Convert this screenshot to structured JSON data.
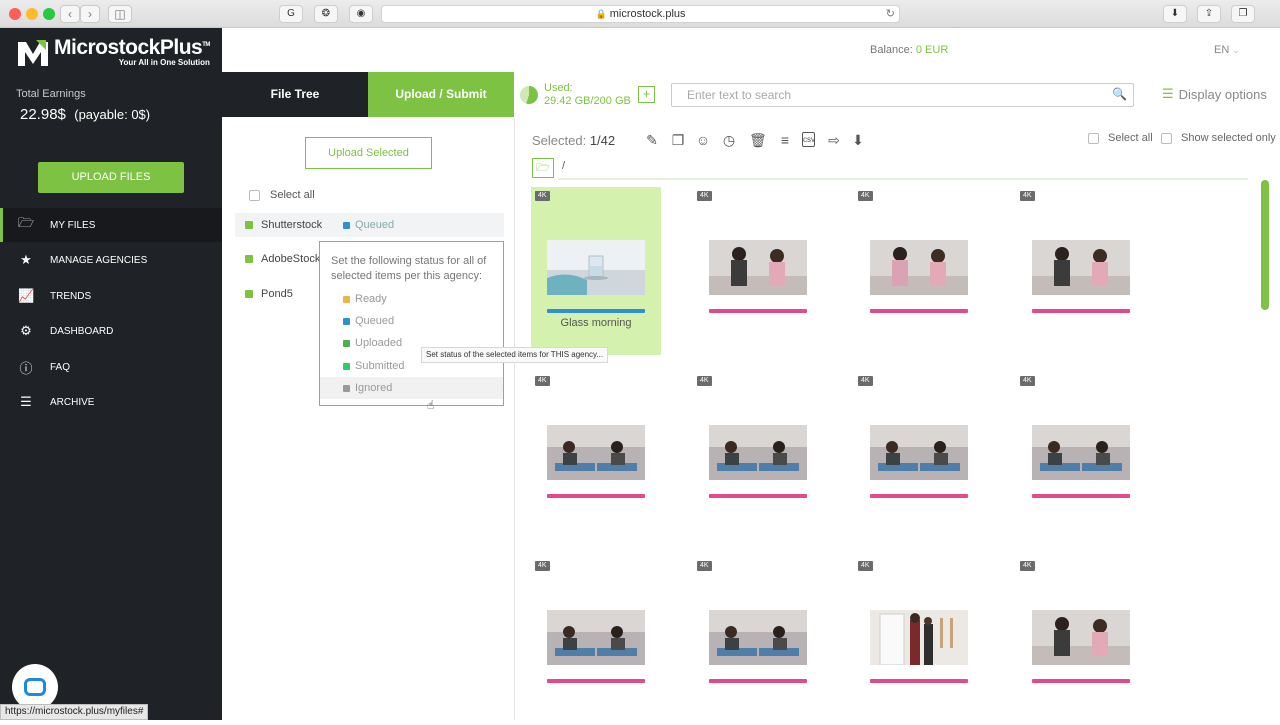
{
  "browser": {
    "url": "microstock.plus",
    "status_url": "https://microstock.plus/myfiles#"
  },
  "logo": {
    "title_a": "Microstock",
    "title_b": "Plus",
    "trademark": "TM",
    "tagline": "Your All in One Solution"
  },
  "sidebar": {
    "earnings_label": "Total Earnings",
    "earnings_value": "22.98$",
    "payable": "(payable: 0$)",
    "upload_button": "UPLOAD FILES",
    "items": [
      {
        "label": "MY FILES",
        "icon": "folder-open-icon"
      },
      {
        "label": "MANAGE AGENCIES",
        "icon": "star-icon"
      },
      {
        "label": "TRENDS",
        "icon": "line-chart-icon"
      },
      {
        "label": "DASHBOARD",
        "icon": "gears-icon"
      },
      {
        "label": "FAQ",
        "icon": "question-circle-icon"
      },
      {
        "label": "ARCHIVE",
        "icon": "list-icon"
      }
    ]
  },
  "topbar": {
    "balance_label": "Balance:",
    "balance_value": "0 EUR",
    "language": "EN"
  },
  "panel": {
    "tab_file_tree": "File Tree",
    "tab_upload": "Upload / Submit",
    "upload_selected": "Upload Selected",
    "select_all": "Select all",
    "agencies": [
      {
        "name": "Shutterstock",
        "status": "Queued"
      },
      {
        "name": "AdobeStock"
      },
      {
        "name": "Pond5"
      }
    ],
    "popup": {
      "text": "Set the following status for all of selected items per this agency:",
      "options": [
        {
          "label": "Ready",
          "color": "#f0b444"
        },
        {
          "label": "Queued",
          "color": "#2d8fd6"
        },
        {
          "label": "Uploaded",
          "color": "#4caf50"
        },
        {
          "label": "Submitted",
          "color": "#2ecc71"
        },
        {
          "label": "Ignored",
          "color": "#999999"
        }
      ]
    },
    "tooltip": "Set status of the selected items for THIS agency..."
  },
  "toolbar": {
    "used_label": "Used:",
    "used_value": "29.42 GB/200 GB",
    "search_placeholder": "Enter text to search",
    "display_options": "Display options",
    "selected_label": "Selected:",
    "selected_value": "1/42",
    "select_all": "Select all",
    "show_selected_only": "Show selected only",
    "path": "/",
    "icons": [
      "pencil-icon",
      "copy-icon",
      "smile-icon",
      "clock-icon",
      "trash-icon",
      "layers-icon",
      "csv-icon",
      "import-icon",
      "download-icon"
    ]
  },
  "grid": {
    "tiles": [
      {
        "badge": "4K",
        "title": "Glass morning",
        "selected": true,
        "bar": "#2d8fd6",
        "scene": "glass"
      },
      {
        "badge": "4K",
        "scene": "girls-talk",
        "bar": "#e24a8d"
      },
      {
        "badge": "4K",
        "scene": "girls-pink",
        "bar": "#e24a8d"
      },
      {
        "badge": "4K",
        "scene": "girls-talk",
        "bar": "#e24a8d"
      },
      {
        "badge": "4K",
        "scene": "girls-couch",
        "bar": "#e24a8d"
      },
      {
        "badge": "4K",
        "scene": "girls-couch",
        "bar": "#e24a8d"
      },
      {
        "badge": "4K",
        "scene": "girls-couch",
        "bar": "#e24a8d"
      },
      {
        "badge": "4K",
        "scene": "girls-couch",
        "bar": "#e24a8d"
      },
      {
        "badge": "4K",
        "scene": "girls-lying",
        "bar": "#e24a8d"
      },
      {
        "badge": "4K",
        "scene": "girls-lying",
        "bar": "#e24a8d"
      },
      {
        "badge": "4K",
        "scene": "doorway",
        "bar": "#e24a8d"
      },
      {
        "badge": "4K",
        "scene": "girls-talk",
        "bar": "#e24a8d"
      }
    ]
  },
  "colors": {
    "accent": "#7dc242",
    "sidebar_bg": "#1f2226",
    "selected_tile": "#d4f2ad"
  }
}
